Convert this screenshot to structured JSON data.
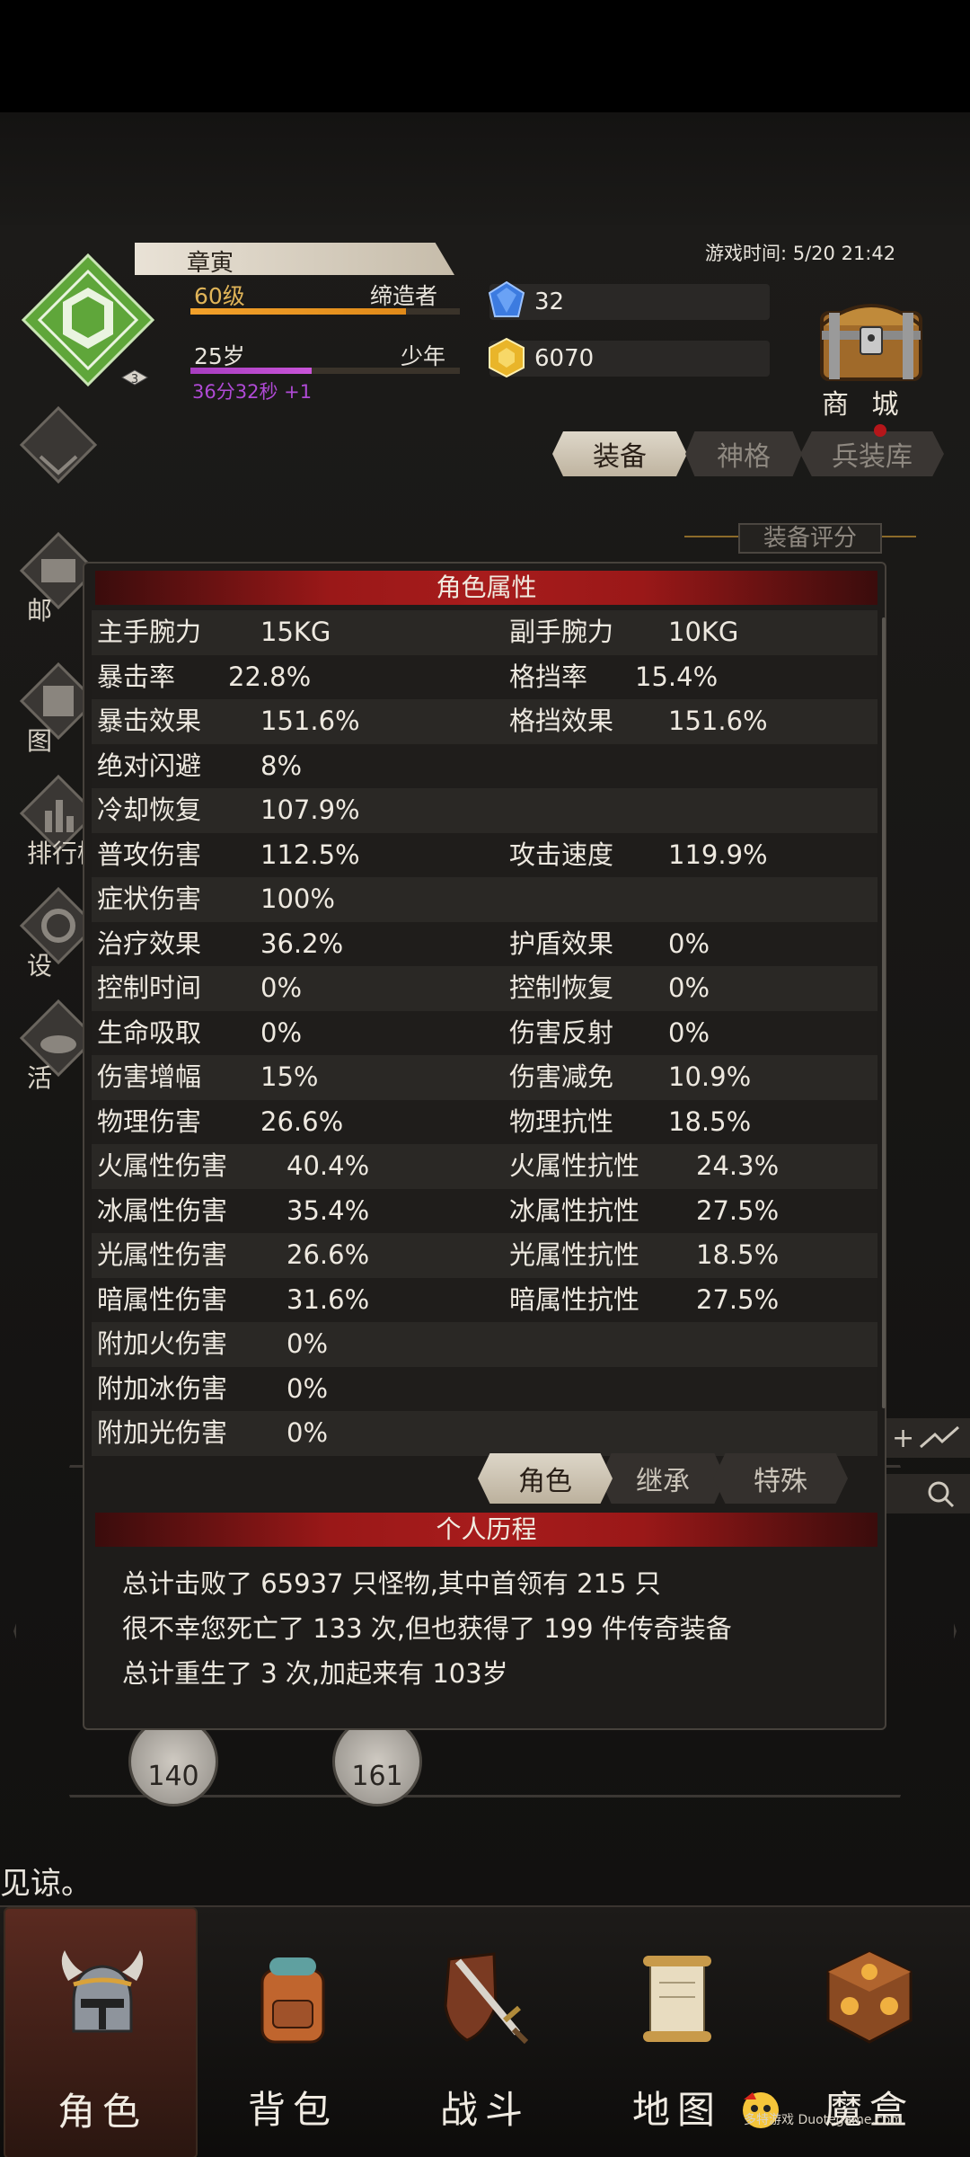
{
  "header": {
    "player_name": "章寅",
    "level": "60级",
    "title": "缔造者",
    "level_progress": 0.8,
    "age": "25岁",
    "life_stage": "少年",
    "age_progress": 0.45,
    "timer": "36分32秒 +1",
    "emblem_badge": "3",
    "diamonds": "32",
    "gold": "6070",
    "game_time": "游戏时间: 5/20 21:42",
    "shop_label": "商 城"
  },
  "left_menu": [
    {
      "label": "邮 件",
      "icon": "mail-icon"
    },
    {
      "label": "图 鉴",
      "icon": "book-icon"
    },
    {
      "label": "排行榜",
      "icon": "ranking-icon"
    },
    {
      "label": "设 置",
      "icon": "gear-icon"
    },
    {
      "label": "活 动",
      "icon": "event-icon"
    }
  ],
  "tabs": [
    "装备",
    "神格",
    "兵装库"
  ],
  "score_label": "装备评分",
  "panel": {
    "attr_title": "角色属性",
    "rows": [
      {
        "l_name": "主手腕力",
        "l_val": "15KG",
        "r_name": "副手腕力",
        "r_val": "10KG"
      },
      {
        "l_name": "暴击率",
        "l_val": "22.8%",
        "r_name": "格挡率",
        "r_val": "15.4%"
      },
      {
        "l_name": "暴击效果",
        "l_val": "151.6%",
        "r_name": "格挡效果",
        "r_val": "151.6%"
      },
      {
        "l_name": "绝对闪避",
        "l_val": "8%",
        "r_name": "",
        "r_val": ""
      },
      {
        "l_name": "冷却恢复",
        "l_val": "107.9%",
        "r_name": "",
        "r_val": ""
      },
      {
        "l_name": "普攻伤害",
        "l_val": "112.5%",
        "r_name": "攻击速度",
        "r_val": "119.9%"
      },
      {
        "l_name": "症状伤害",
        "l_val": "100%",
        "r_name": "",
        "r_val": ""
      },
      {
        "l_name": "治疗效果",
        "l_val": "36.2%",
        "r_name": "护盾效果",
        "r_val": "0%"
      },
      {
        "l_name": "控制时间",
        "l_val": "0%",
        "r_name": "控制恢复",
        "r_val": "0%"
      },
      {
        "l_name": "生命吸取",
        "l_val": "0%",
        "r_name": "伤害反射",
        "r_val": "0%"
      },
      {
        "l_name": "伤害增幅",
        "l_val": "15%",
        "r_name": "伤害减免",
        "r_val": "10.9%"
      },
      {
        "l_name": "物理伤害",
        "l_val": "26.6%",
        "r_name": "物理抗性",
        "r_val": "18.5%"
      },
      {
        "l_name": "火属性伤害",
        "l_val": "40.4%",
        "r_name": "火属性抗性",
        "r_val": "24.3%"
      },
      {
        "l_name": "冰属性伤害",
        "l_val": "35.4%",
        "r_name": "冰属性抗性",
        "r_val": "27.5%"
      },
      {
        "l_name": "光属性伤害",
        "l_val": "26.6%",
        "r_name": "光属性抗性",
        "r_val": "18.5%"
      },
      {
        "l_name": "暗属性伤害",
        "l_val": "31.6%",
        "r_name": "暗属性抗性",
        "r_val": "27.5%"
      },
      {
        "l_name": "附加火伤害",
        "l_val": "0%",
        "r_name": "",
        "r_val": ""
      },
      {
        "l_name": "附加冰伤害",
        "l_val": "0%",
        "r_name": "",
        "r_val": ""
      },
      {
        "l_name": "附加光伤害",
        "l_val": "0%",
        "r_name": "",
        "r_val": ""
      }
    ],
    "sub_tabs": [
      "角色",
      "继承",
      "特殊"
    ],
    "history_title": "个人历程",
    "history_lines": [
      "总计击败了 65937 只怪物,其中首领有 215 只",
      "很不幸您死亡了 133 次,但也获得了 199 件传奇装备",
      "总计重生了 3 次,加起来有 103岁"
    ]
  },
  "background": {
    "dial_left": "140",
    "dial_right": "161",
    "message": "见谅。"
  },
  "bottom_nav": [
    {
      "label": "角色",
      "icon": "helmet-icon",
      "active": true
    },
    {
      "label": "背包",
      "icon": "backpack-icon",
      "active": false
    },
    {
      "label": "战斗",
      "icon": "sword-shield-icon",
      "active": false
    },
    {
      "label": "地图",
      "icon": "scroll-map-icon",
      "active": false
    },
    {
      "label": "魔盒",
      "icon": "magic-box-icon",
      "active": false
    }
  ],
  "watermark": "多特游戏 Duotegame.com",
  "colors": {
    "accent_red": "#a71c1c",
    "level_bar": "#f2a12a",
    "age_bar": "#c954d8",
    "emblem_green": "#5fa63a"
  }
}
